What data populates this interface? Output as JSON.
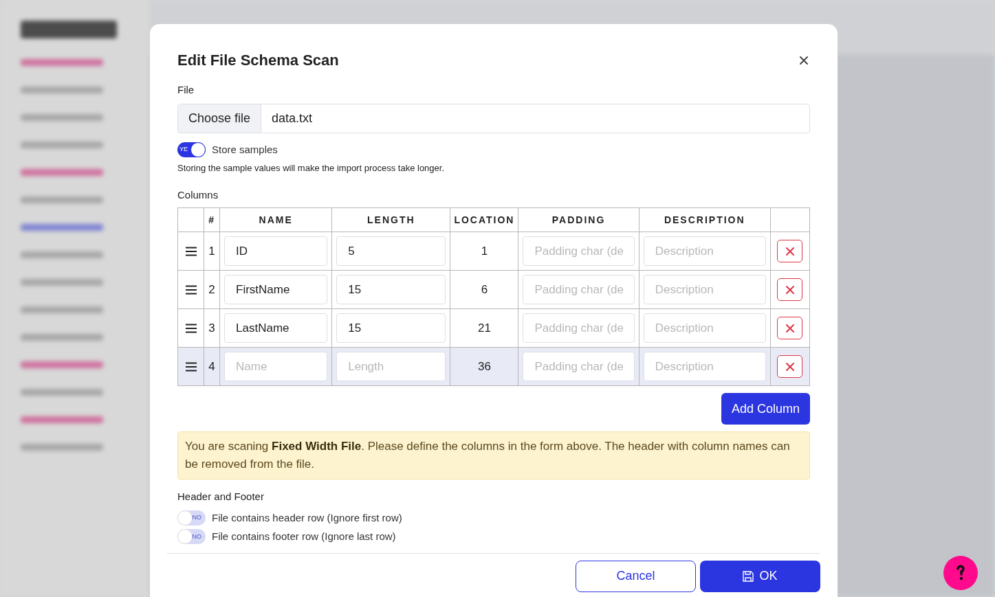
{
  "dialog": {
    "title": "Edit File Schema Scan",
    "file": {
      "label": "File",
      "button": "Choose file",
      "value": "data.txt"
    },
    "store_samples": {
      "on": true,
      "toggle_text": "YE",
      "label": "Store samples",
      "hint": "Storing the sample values will make the import process take longer."
    },
    "columns_label": "Columns",
    "table": {
      "columns": [
        "#",
        "NAME",
        "LENGTH",
        "LOCATION",
        "PADDING",
        "DESCRIPTION"
      ],
      "rows": [
        {
          "index": "1",
          "name": "ID",
          "length": "5",
          "location": "1",
          "padding_placeholder": "Padding char (de",
          "description_placeholder": "Description",
          "selected": false
        },
        {
          "index": "2",
          "name": "FirstName",
          "length": "15",
          "location": "6",
          "padding_placeholder": "Padding char (de",
          "description_placeholder": "Description",
          "selected": false
        },
        {
          "index": "3",
          "name": "LastName",
          "length": "15",
          "location": "21",
          "padding_placeholder": "Padding char (de",
          "description_placeholder": "Description",
          "selected": false
        },
        {
          "index": "4",
          "name_placeholder": "Name",
          "length_placeholder": "Length",
          "location": "36",
          "padding_placeholder": "Padding char (de",
          "description_placeholder": "Description",
          "selected": true
        }
      ]
    },
    "add_column": "Add Column",
    "notice": "You are scaning **Fixed Width File**. Please define the columns in the form above. The header with column names can be removed from the file.",
    "header_footer": {
      "label": "Header and Footer",
      "options": [
        {
          "label": "File contains header row (Ignore first row)",
          "on": false,
          "toggle_text": "NO"
        },
        {
          "label": "File contains footer row (Ignore last row)",
          "on": false,
          "toggle_text": "NO"
        }
      ]
    },
    "buttons": {
      "cancel": "Cancel",
      "ok": "OK"
    }
  }
}
